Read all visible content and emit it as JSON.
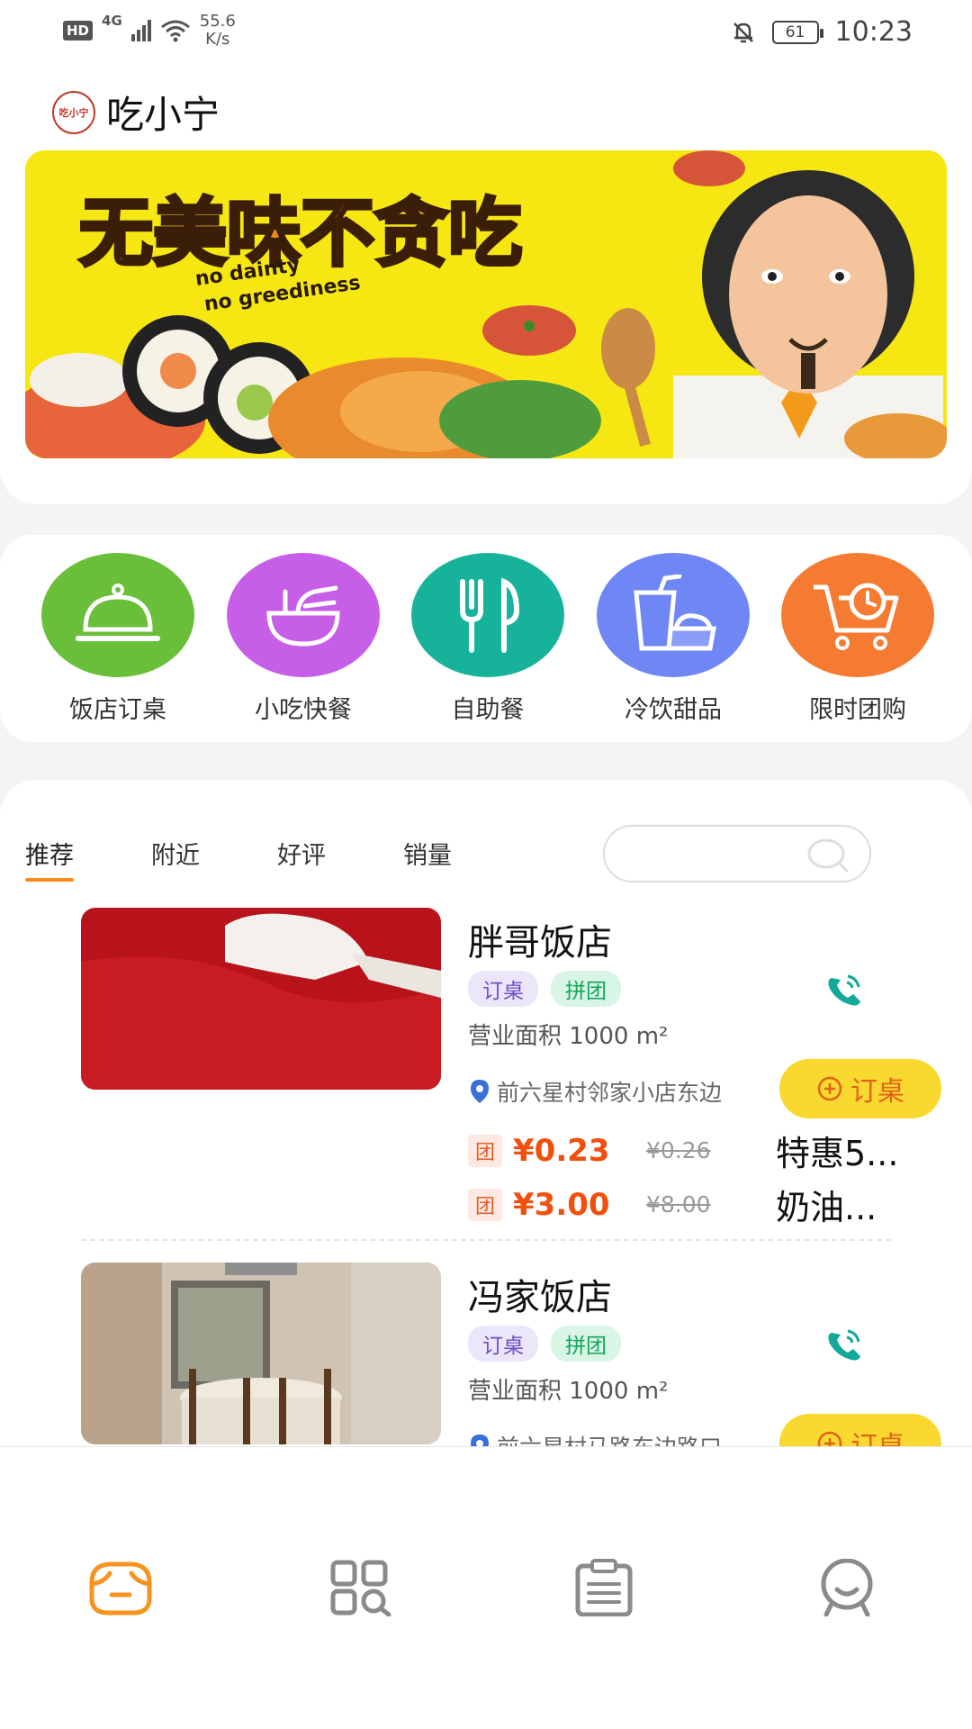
{
  "status_bar": {
    "hd": "HD",
    "network": "4G",
    "speed_value": "55.6",
    "speed_unit": "K/s",
    "battery": "61",
    "time": "10:23"
  },
  "app": {
    "logo_text": "吃小宁",
    "name": "吃小宁"
  },
  "banner": {
    "headline": "无美味不贪吃",
    "subline_1": "no dainty",
    "subline_2": "no greediness"
  },
  "categories": [
    {
      "label": "饭店订桌",
      "color": "#6abf3a"
    },
    {
      "label": "小吃快餐",
      "color": "#c65ee8"
    },
    {
      "label": "自助餐",
      "color": "#16b39a"
    },
    {
      "label": "冷饮甜品",
      "color": "#6f86f5"
    },
    {
      "label": "限时团购",
      "color": "#f57b32"
    }
  ],
  "tabs": [
    "推荐",
    "附近",
    "好评",
    "销量"
  ],
  "search": {
    "placeholder": ""
  },
  "shops": [
    {
      "name": "胖哥饭店",
      "tags": [
        "订桌",
        "拼团"
      ],
      "area": "营业面积 1000 m²",
      "address": "前六星村邻家小店东边",
      "book_label": "订桌",
      "deals": [
        {
          "badge": "团",
          "price": "¥0.23",
          "original": "¥0.26",
          "name": "特惠5..."
        },
        {
          "badge": "团",
          "price": "¥3.00",
          "original": "¥8.00",
          "name": "奶油..."
        }
      ]
    },
    {
      "name": "冯家饭店",
      "tags": [
        "订桌",
        "拼团"
      ],
      "area": "营业面积 1000 m²",
      "address": "前六星村马路东边路口",
      "book_label": "订桌"
    }
  ],
  "colors": {
    "accent": "#ff8a1a",
    "price": "#f0500f",
    "book_button": "#f9d92f",
    "phone": "#12a89a"
  },
  "bottom_nav": [
    "home-icon",
    "discover-icon",
    "orders-icon",
    "profile-icon"
  ]
}
